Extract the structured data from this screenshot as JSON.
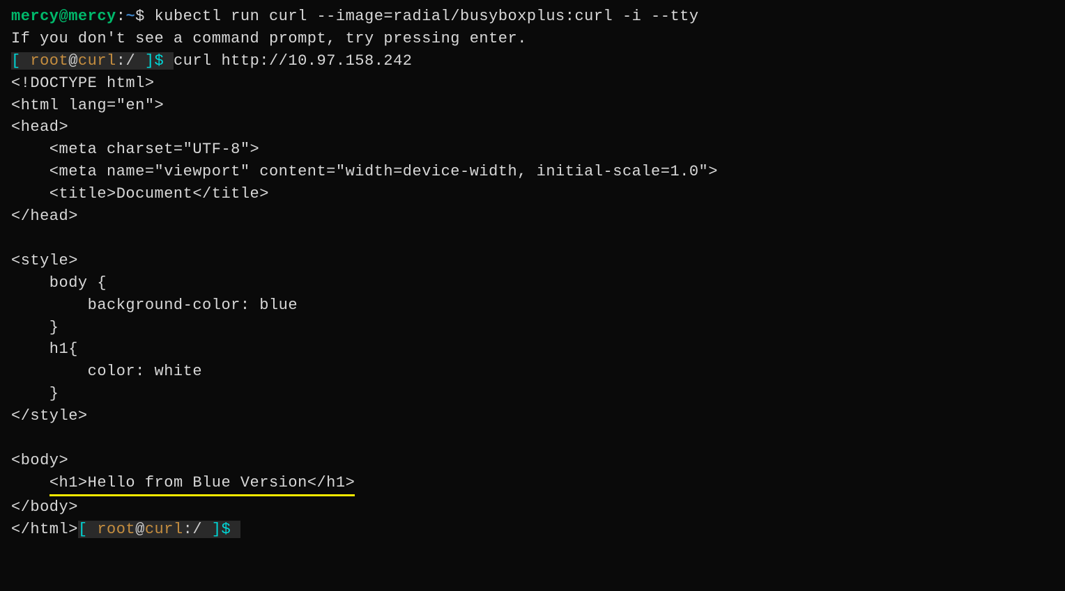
{
  "line1": {
    "user_host": "mercy@mercy",
    "colon": ":",
    "path": "~",
    "dollar": "$ ",
    "command": "kubectl run curl --image=radial/busyboxplus:curl -i --tty"
  },
  "line2": "If you don't see a command prompt, try pressing enter.",
  "line3": {
    "bracket_open": "[ ",
    "user": "root",
    "at": "@",
    "host": "curl",
    "colon": ":",
    "path": "/",
    "bracket_close": " ]",
    "dollar": "$ ",
    "command": "curl http://10.97.158.242"
  },
  "html_output": {
    "l1": "<!DOCTYPE html>",
    "l2": "<html lang=\"en\">",
    "l3": "<head>",
    "l4": "    <meta charset=\"UTF-8\">",
    "l5": "    <meta name=\"viewport\" content=\"width=device-width, initial-scale=1.0\">",
    "l6": "    <title>Document</title>",
    "l7": "</head>",
    "l8": "<style>",
    "l9": "    body {",
    "l10": "        background-color: blue",
    "l11": "    }",
    "l12": "    h1{",
    "l13": "        color: white",
    "l14": "    }",
    "l15": "</style>",
    "l16_prefix": "    ",
    "l16_h1": "<h1>Hello from Blue Version</h1>",
    "l17": "<body>",
    "l18": "</body>",
    "l19": "</html>"
  },
  "line_end": {
    "bracket_open": "[ ",
    "user": "root",
    "at": "@",
    "host": "curl",
    "colon": ":",
    "path": "/",
    "bracket_close": " ]",
    "dollar": "$ "
  }
}
